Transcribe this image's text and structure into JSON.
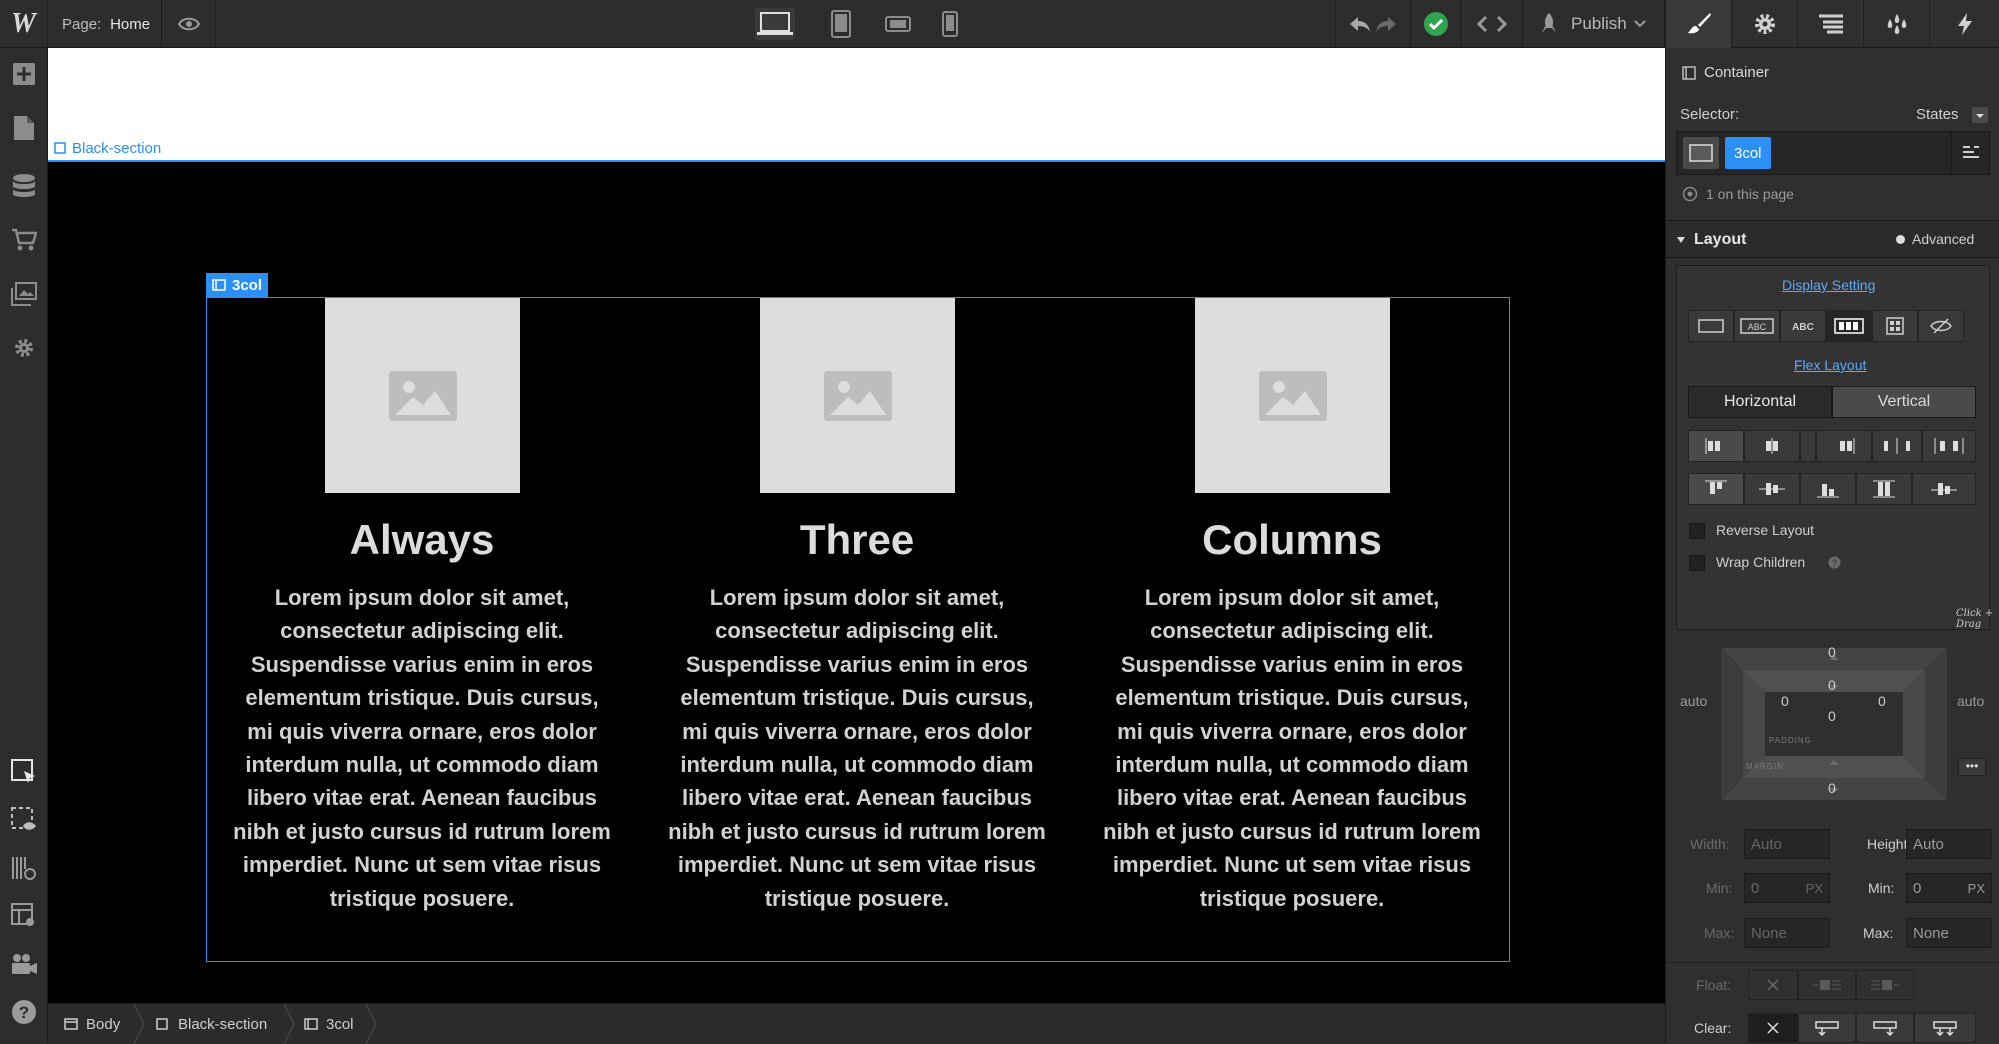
{
  "topbar": {
    "logo": "W",
    "page_label": "Page:",
    "page_name": "Home",
    "publish": "Publish"
  },
  "canvas": {
    "section_label": "Black-section",
    "container_label": "3col",
    "columns": [
      {
        "title": "Always",
        "body": "Lorem ipsum dolor sit amet, consectetur adipiscing elit. Suspendisse varius enim in eros elementum tristique. Duis cursus, mi quis viverra ornare, eros dolor interdum nulla, ut commodo diam libero vitae erat. Aenean faucibus nibh et justo cursus id rutrum lorem imperdiet. Nunc ut sem vitae risus tristique posuere."
      },
      {
        "title": "Three",
        "body": "Lorem ipsum dolor sit amet, consectetur adipiscing elit. Suspendisse varius enim in eros elementum tristique. Duis cursus, mi quis viverra ornare, eros dolor interdum nulla, ut commodo diam libero vitae erat. Aenean faucibus nibh et justo cursus id rutrum lorem imperdiet. Nunc ut sem vitae risus tristique posuere."
      },
      {
        "title": "Columns",
        "body": "Lorem ipsum dolor sit amet, consectetur adipiscing elit. Suspendisse varius enim in eros elementum tristique. Duis cursus, mi quis viverra ornare, eros dolor interdum nulla, ut commodo diam libero vitae erat. Aenean faucibus nibh et justo cursus id rutrum lorem imperdiet. Nunc ut sem vitae risus tristique posuere."
      }
    ]
  },
  "breadcrumbs": [
    "Body",
    "Black-section",
    "3col"
  ],
  "panel": {
    "element_type": "Container",
    "selector_label": "Selector:",
    "states_label": "States",
    "selector_class": "3col",
    "on_page": "1 on this page",
    "layout_title": "Layout",
    "advanced": "Advanced",
    "display_setting": "Display Setting",
    "flex_layout": "Flex Layout",
    "horizontal": "Horizontal",
    "vertical": "Vertical",
    "reverse_layout": "Reverse Layout",
    "wrap_children": "Wrap Children",
    "box": {
      "margin_top": "0",
      "margin_bottom": "0",
      "margin_left": "auto",
      "margin_right": "auto",
      "padding_top": "0",
      "padding_bottom": "0",
      "padding_left": "0",
      "padding_right": "0",
      "padding_label": "PADDING",
      "margin_label": "MARGIN",
      "hint": "Click + Drag"
    },
    "width_label": "Width:",
    "width_value": "Auto",
    "height_label": "Height:",
    "height_value": "Auto",
    "min_label_left": "Min:",
    "min_value_left": "0",
    "min_unit_left": "PX",
    "min_label_right": "Min:",
    "min_value_right": "0",
    "min_unit_right": "PX",
    "max_label_left": "Max:",
    "max_value_left": "None",
    "max_label_right": "Max:",
    "max_value_right": "None",
    "float_label": "Float:",
    "clear_label": "Clear:"
  },
  "colors": {
    "accent": "#2b8ff5",
    "success": "#2ea44f",
    "section_bg": "#000000"
  }
}
